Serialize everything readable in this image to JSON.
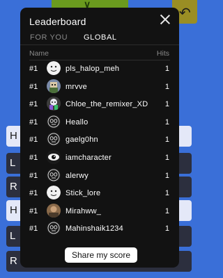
{
  "modal": {
    "title": "Leaderboard",
    "tabs": [
      {
        "label": "FOR YOU",
        "active": false
      },
      {
        "label": "GLOBAL",
        "active": true
      }
    ],
    "columns": {
      "name": "Name",
      "hits": "Hits"
    },
    "share_label": "Share my score"
  },
  "leaderboard": [
    {
      "rank": "#1",
      "name": "pls_halop_meh",
      "hits": "1",
      "avatar": "white-face"
    },
    {
      "rank": "#1",
      "name": "mrvve",
      "hits": "1",
      "avatar": "pixel-character"
    },
    {
      "rank": "#1",
      "name": "Chloe_the_remixer_XD",
      "hits": "1",
      "avatar": "colorful-character"
    },
    {
      "rank": "#1",
      "name": "Heallo",
      "hits": "1",
      "avatar": "mask-outline"
    },
    {
      "rank": "#1",
      "name": "gaelg0hn",
      "hits": "1",
      "avatar": "mask-outline"
    },
    {
      "rank": "#1",
      "name": "iamcharacter",
      "hits": "1",
      "avatar": "eye"
    },
    {
      "rank": "#1",
      "name": "alerwy",
      "hits": "1",
      "avatar": "mask-outline"
    },
    {
      "rank": "#1",
      "name": "Stick_lore",
      "hits": "1",
      "avatar": "white-face"
    },
    {
      "rank": "#1",
      "name": "Mirahww_",
      "hits": "1",
      "avatar": "photo"
    },
    {
      "rank": "#1",
      "name": "Mahinshaik1234",
      "hits": "1",
      "avatar": "mask-outline"
    }
  ],
  "background": {
    "buttons": [
      "H",
      "L",
      "R",
      "H",
      "L",
      "R"
    ]
  },
  "colors": {
    "background": "#3a6fd8",
    "modal": "#121212",
    "text": "#ffffff",
    "muted": "#8a8a8a"
  }
}
